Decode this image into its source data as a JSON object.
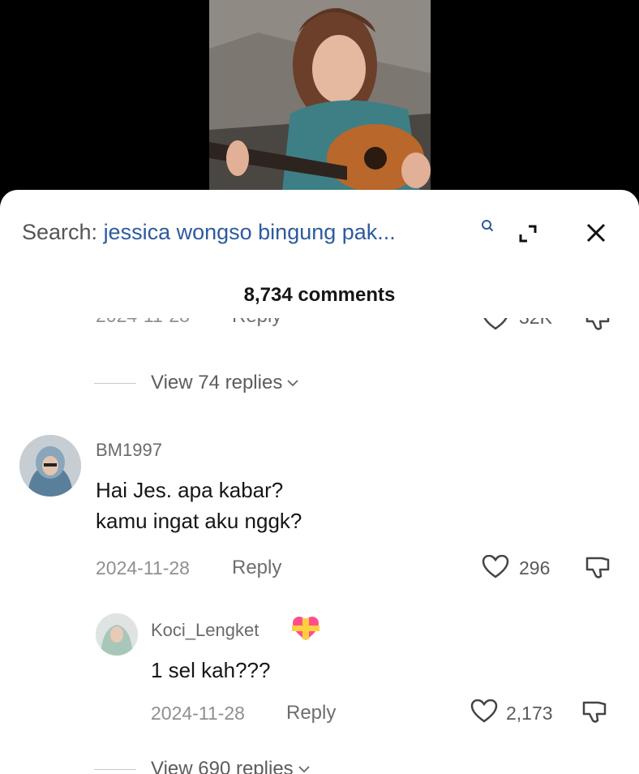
{
  "search": {
    "prefix": "Search: ",
    "query": "jessica wongso bingung pak..."
  },
  "comments_header": {
    "count_label": "8,734 comments"
  },
  "clipped_top": {
    "date": "2024-11-28",
    "reply_label": "Reply",
    "likes": "32K"
  },
  "thread1": {
    "view_replies": "View 74 replies"
  },
  "comment1": {
    "username": "BM1997",
    "text": "Hai Jes. apa kabar?\nkamu ingat aku nggk?",
    "date": "2024-11-28",
    "reply_label": "Reply",
    "likes": "296"
  },
  "reply1": {
    "username": "Koci_Lengket",
    "text": "1 sel kah???",
    "date": "2024-11-28",
    "reply_label": "Reply",
    "likes": "2,173"
  },
  "thread2": {
    "view_replies": "View 690 replies"
  },
  "colors": {
    "query_blue": "#2d5a9e",
    "sheet_bg": "#ffffff",
    "backdrop": "#000000"
  },
  "icons": [
    "search-icon",
    "expand-icon",
    "close-icon",
    "heart-icon",
    "dislike-icon",
    "chevron-down-icon",
    "heart-ribbon-emoji"
  ]
}
